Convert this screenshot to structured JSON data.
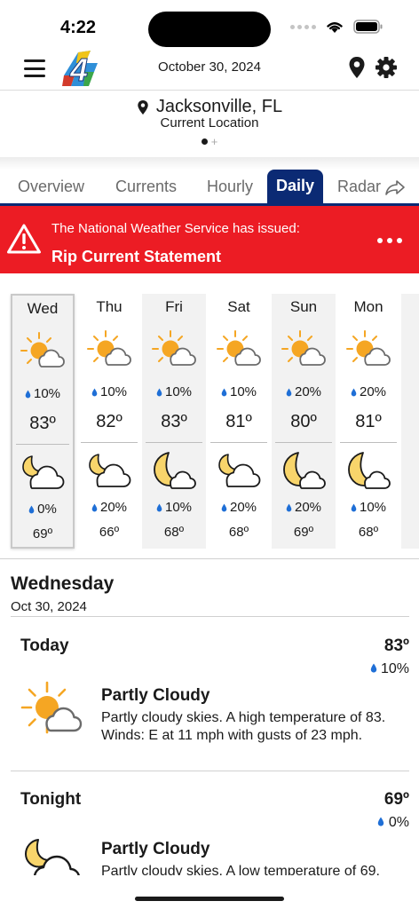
{
  "status_bar": {
    "time": "4:22"
  },
  "header": {
    "date": "October 30, 2024",
    "logo_text": "4"
  },
  "location": {
    "name": "Jacksonville, FL",
    "subtitle": "Current Location",
    "add_symbol": "+"
  },
  "tabs": [
    {
      "label": "Overview"
    },
    {
      "label": "Currents"
    },
    {
      "label": "Hourly"
    },
    {
      "label": "Daily"
    },
    {
      "label": "Radar"
    }
  ],
  "active_tab": "Daily",
  "alert": {
    "line1": "The National Weather Service has issued:",
    "line2": "Rip Current Statement",
    "color": "#ec1c24"
  },
  "forecast": [
    {
      "day": "Wed",
      "day_precip": "10%",
      "high": "83º",
      "night_icon": "moon-cloud-icon",
      "night_precip": "0%",
      "low": "69º"
    },
    {
      "day": "Thu",
      "day_precip": "10%",
      "high": "82º",
      "night_icon": "moon-cloud-icon",
      "night_precip": "20%",
      "low": "66º"
    },
    {
      "day": "Fri",
      "day_precip": "10%",
      "high": "83º",
      "night_icon": "crescent-cloud-icon",
      "night_precip": "10%",
      "low": "68º"
    },
    {
      "day": "Sat",
      "day_precip": "10%",
      "high": "81º",
      "night_icon": "moon-cloud-icon",
      "night_precip": "20%",
      "low": "68º"
    },
    {
      "day": "Sun",
      "day_precip": "20%",
      "high": "80º",
      "night_icon": "crescent-cloud-icon",
      "night_precip": "20%",
      "low": "69º"
    },
    {
      "day": "Mon",
      "day_precip": "20%",
      "high": "81º",
      "night_icon": "crescent-cloud-icon",
      "night_precip": "10%",
      "low": "68º"
    }
  ],
  "detail": {
    "day": "Wednesday",
    "date": "Oct 30, 2024",
    "periods": [
      {
        "name": "Today",
        "temp": "83º",
        "precip": "10%",
        "condition": "Partly Cloudy",
        "description": "Partly cloudy skies. A high temperature of 83. Winds: E at 11 mph with gusts of 23 mph."
      },
      {
        "name": "Tonight",
        "temp": "69º",
        "precip": "0%",
        "condition": "Partly Cloudy",
        "description": "Partly cloudy skies. A low temperature of 69."
      }
    ]
  },
  "colors": {
    "accent": "#0b2a74",
    "sun": "#f5a623",
    "moon": "#f8d56b",
    "drop": "#1f6fd6"
  }
}
